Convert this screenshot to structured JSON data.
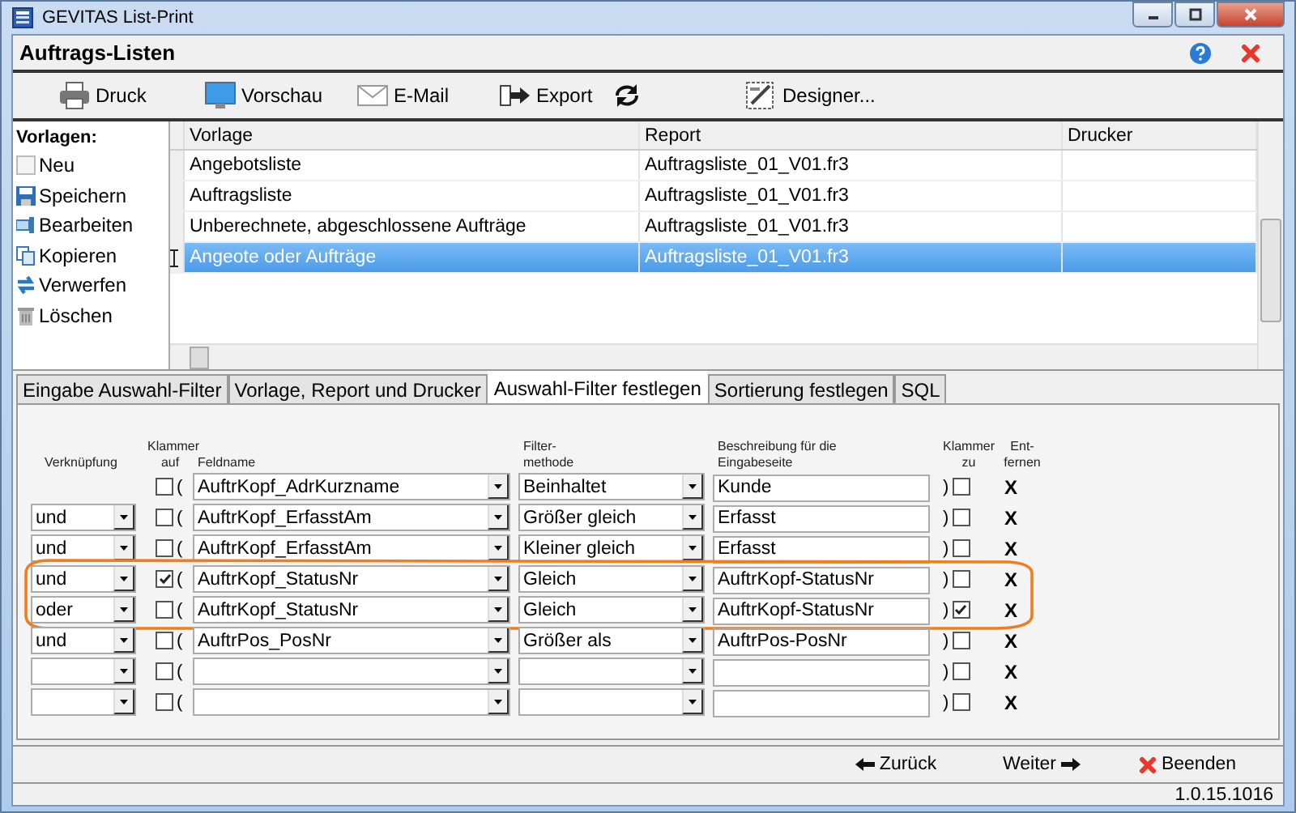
{
  "window": {
    "title": "GEVITAS List-Print"
  },
  "header": {
    "title": "Auftrags-Listen"
  },
  "toolbar": [
    {
      "kind": "labeled",
      "label": "Druck"
    },
    {
      "kind": "labeled",
      "label": "Vorschau"
    },
    {
      "kind": "labeled",
      "label": "E-Mail"
    },
    {
      "kind": "labeled",
      "label": "Export"
    },
    {
      "kind": "icon"
    },
    {
      "kind": "labeled",
      "label": "Designer..."
    }
  ],
  "sidebar": {
    "title": "Vorlagen:",
    "items": [
      {
        "label": "Neu"
      },
      {
        "label": "Speichern"
      },
      {
        "label": "Bearbeiten"
      },
      {
        "label": "Kopieren"
      },
      {
        "label": "Verwerfen"
      },
      {
        "label": "Löschen"
      }
    ]
  },
  "table": {
    "columns": [
      "Vorlage",
      "Report",
      "Drucker"
    ],
    "rows": [
      {
        "cells": [
          "Angebotsliste",
          "Auftragsliste_01_V01.fr3"
        ],
        "selected": false
      },
      {
        "cells": [
          "Auftragsliste",
          "Auftragsliste_01_V01.fr3"
        ],
        "selected": false
      },
      {
        "cells": [
          "Unberechnete, abgeschlossene Aufträge",
          "Auftragsliste_01_V01.fr3"
        ],
        "selected": false
      },
      {
        "cells": [
          "Angeote oder Aufträge",
          "Auftragsliste_01_V01.fr3"
        ],
        "selected": true
      }
    ]
  },
  "tabs": [
    {
      "label": "Eingabe Auswahl-Filter",
      "selected": false
    },
    {
      "label": "Vorlage, Report und Drucker",
      "selected": false
    },
    {
      "label": "Auswahl-Filter festlegen",
      "selected": true
    },
    {
      "label": "Sortierung festlegen",
      "selected": false
    },
    {
      "label": "SQL",
      "selected": false
    }
  ],
  "filter_columns": [
    {
      "lines": [
        "Verknüpfung"
      ]
    },
    {
      "lines": [
        "Klammer",
        "auf"
      ]
    },
    {
      "lines": [
        "Feldname"
      ]
    },
    {
      "lines": [
        "Filter-",
        "methode"
      ]
    },
    {
      "lines": [
        "Beschreibung für die",
        "Eingabeseite"
      ]
    },
    {
      "lines": [
        "Klammer",
        "zu"
      ]
    },
    {
      "lines": [
        "Ent-",
        "fernen"
      ]
    }
  ],
  "filters": [
    {
      "kind": "first",
      "open": "(",
      "open_checked": false,
      "field": "AuftrKopf_AdrKurzname",
      "method": "Beinhaltet",
      "description": "Kunde",
      "close": ")",
      "close_checked": false,
      "remove": "X",
      "highlighted": false
    },
    {
      "kind": "condition",
      "join": "und",
      "open": "(",
      "open_checked": false,
      "field": "AuftrKopf_ErfasstAm",
      "method": "Größer gleich",
      "description": "Erfasst",
      "close": ")",
      "close_checked": false,
      "remove": "X",
      "highlighted": false
    },
    {
      "kind": "condition",
      "join": "und",
      "open": "(",
      "open_checked": false,
      "field": "AuftrKopf_ErfasstAm",
      "method": "Kleiner gleich",
      "description": "Erfasst",
      "close": ")",
      "close_checked": false,
      "remove": "X",
      "highlighted": false
    },
    {
      "kind": "condition",
      "join": "und",
      "open": "(",
      "open_checked": true,
      "field": "AuftrKopf_StatusNr",
      "method": "Gleich",
      "description": "AuftrKopf-StatusNr",
      "close": ")",
      "close_checked": false,
      "remove": "X",
      "highlighted": true
    },
    {
      "kind": "condition",
      "join": "oder",
      "open": "(",
      "open_checked": false,
      "field": "AuftrKopf_StatusNr",
      "method": "Gleich",
      "description": "AuftrKopf-StatusNr",
      "close": ")",
      "close_checked": true,
      "remove": "X",
      "highlighted": true
    },
    {
      "kind": "condition",
      "join": "und",
      "open": "(",
      "open_checked": false,
      "field": "AuftrPos_PosNr",
      "method": "Größer als",
      "description": "AuftrPos-PosNr",
      "close": ")",
      "close_checked": false,
      "remove": "X",
      "highlighted": false
    },
    {
      "kind": "condition",
      "open": "(",
      "open_checked": false,
      "close": ")",
      "close_checked": false,
      "remove": "X",
      "highlighted": false
    },
    {
      "kind": "condition",
      "open": "(",
      "open_checked": false,
      "close": ")",
      "close_checked": false,
      "remove": "X",
      "highlighted": false
    }
  ],
  "footer": {
    "back": "Zurück",
    "next": "Weiter",
    "quit": "Beenden"
  },
  "status_bar": {
    "version": "1.0.15.1016"
  }
}
